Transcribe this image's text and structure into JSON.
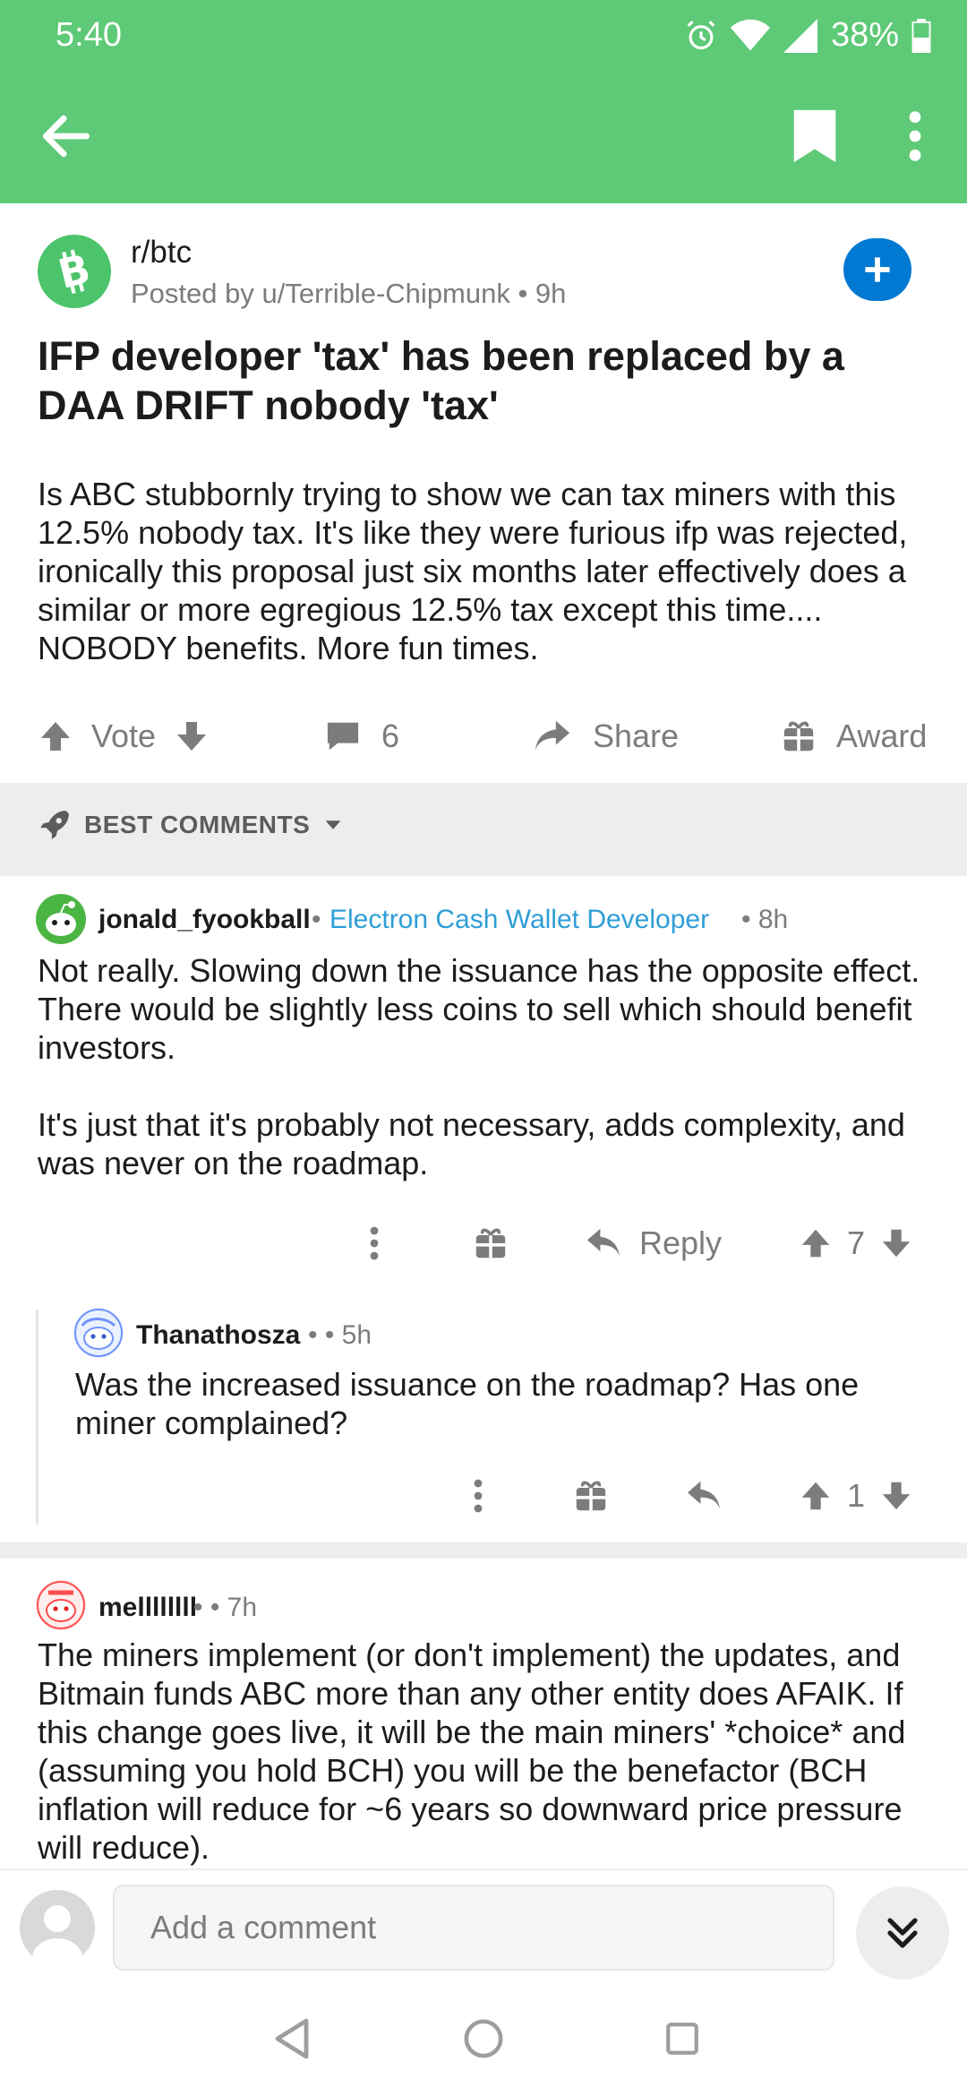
{
  "status": {
    "time": "5:40",
    "battery": "38%"
  },
  "post": {
    "subreddit": "r/btc",
    "meta": "Posted by u/Terrible-Chipmunk • 9h",
    "title": "IFP developer 'tax' has been replaced by a DAA DRIFT nobody 'tax'",
    "body": "Is ABC stubbornly trying to show we can tax miners with this 12.5% nobody tax.  It's like they were furious ifp was rejected, ironically this proposal just six months later effectively does a similar or more egregious 12.5% tax except this time.... NOBODY benefits.   More fun times.",
    "vote_label": "Vote",
    "comment_count": "6",
    "share_label": "Share",
    "award_label": "Award"
  },
  "sort": {
    "label": "BEST COMMENTS"
  },
  "comments": [
    {
      "user": "jonald_fyookball",
      "flair": "Electron Cash Wallet Developer",
      "meta": "• 8h",
      "body_lines": [
        "Not really.  Slowing down the issuance has the opposite effect.  There would be slightly less coins to sell which should benefit investors.",
        "It's just that it's probably not necessary, adds complexity, and was never on the roadmap."
      ],
      "reply_label": "Reply",
      "score": "7"
    },
    {
      "user": "Thanathosza",
      "meta": "• • 5h",
      "body": "Was the increased issuance on the roadmap? Has one miner complained?",
      "score": "1"
    },
    {
      "user": "mellllllll",
      "meta": "• • 7h",
      "body": "The miners implement (or don't implement) the updates, and Bitmain funds ABC more than any other entity does AFAIK. If this change goes live, it will be the main miners' *choice* and (assuming you hold BCH) you will be the benefactor (BCH inflation will reduce for ~6 years so downward price pressure will reduce)."
    }
  ],
  "composer": {
    "placeholder": "Add a comment"
  },
  "colors": {
    "accent_green": "#5ec977",
    "join_blue": "#0079d3",
    "flair_blue": "#2f9ed6"
  },
  "icons": {
    "back": "arrow-left-icon",
    "bookmark": "bookmark-icon",
    "more": "more-vertical-icon",
    "upvote": "arrow-up-icon",
    "downvote": "arrow-down-icon",
    "comment": "comment-icon",
    "share": "share-icon",
    "award": "gift-icon",
    "sort": "rocket-icon",
    "reply": "reply-icon"
  }
}
